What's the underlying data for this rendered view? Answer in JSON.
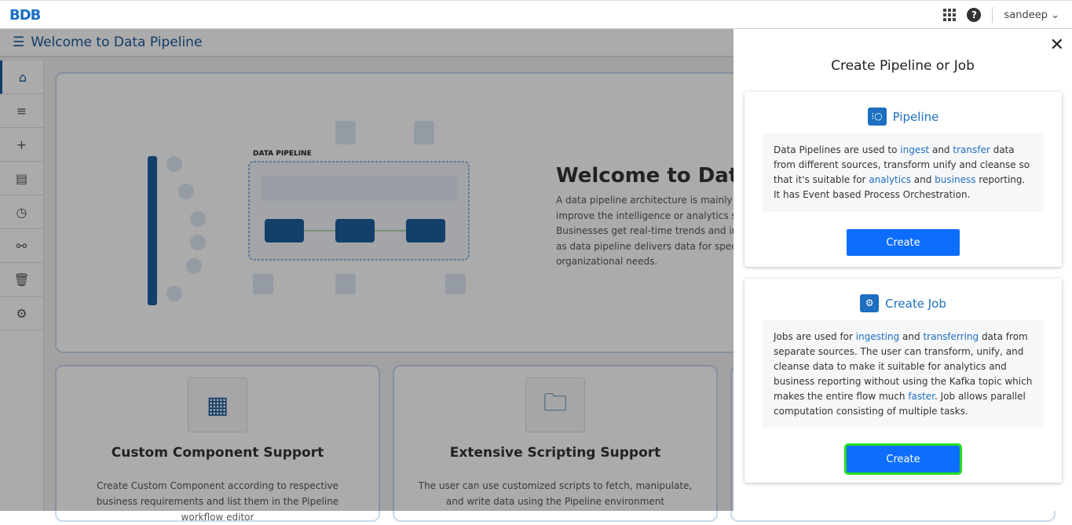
{
  "topbar": {
    "logo": "BDB",
    "user": "sandeep"
  },
  "header": {
    "title": "Welcome to Data Pipeline"
  },
  "sidebar": [
    "home",
    "list",
    "add",
    "library",
    "history",
    "workflow",
    "trash",
    "settings"
  ],
  "hero": {
    "title": "Welcome to Data Pipeline",
    "text": "A data pipeline architecture is mainly applied to improve the intelligence or analytics software. Businesses get real-time trends and information as data pipeline delivers data for specified organizational needs.",
    "diagram_title": "DATA PIPELINE"
  },
  "features": [
    {
      "title": "Custom Component Support",
      "text": "Create Custom Component according to respective business requirements and list them in the Pipeline workflow editor"
    },
    {
      "title": "Extensive Scripting Support",
      "text": "The user can use customized scripts to fetch, manipulate, and write data using the Pipeline environment"
    }
  ],
  "drawer": {
    "title": "Create Pipeline or Job",
    "pipeline": {
      "title": "Pipeline",
      "t1": "Data Pipelines are used to ",
      "l1": "ingest",
      "t2": " and ",
      "l2": "transfer",
      "t3": " data from different sources, transform unify and cleanse so that it's suitable for ",
      "l3": "analytics",
      "t4": " and ",
      "l4": "business",
      "t5": " reporting. It has Event based Process Orchestration.",
      "button": "Create"
    },
    "job": {
      "title": "Create Job",
      "t1": "Jobs are used for ",
      "l1": "ingesting",
      "t2": " and ",
      "l2": "transferring",
      "t3": " data from separate sources. The user can transform, unify, and cleanse data to make it suitable for analytics and business reporting without using the Kafka topic which makes the entire flow much ",
      "l3": "faster",
      "t4": ". Job allows parallel computation consisting of multiple tasks.",
      "button": "Create"
    }
  }
}
